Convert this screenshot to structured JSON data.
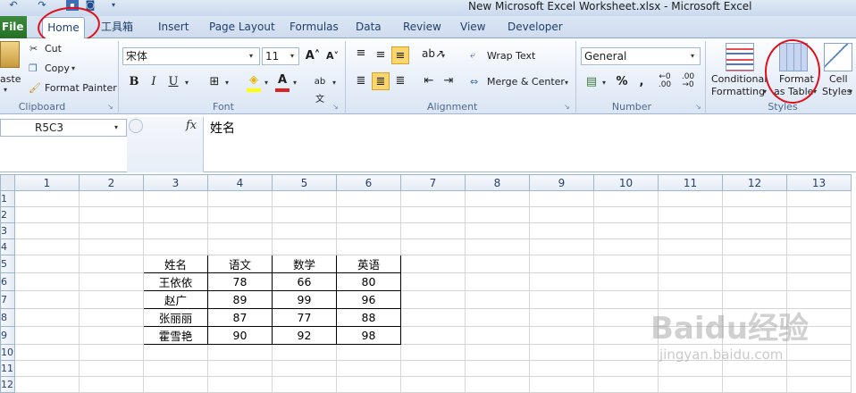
{
  "window": {
    "title": "New Microsoft Excel Worksheet.xlsx  -  Microsoft Excel"
  },
  "quick_access": {
    "icons": [
      "undo-icon",
      "redo-icon",
      "save-icon",
      "camera-icon",
      "customize-dropdown-icon"
    ]
  },
  "tabs": {
    "file": "File",
    "home": "Home",
    "items": [
      "工具箱",
      "Insert",
      "Page Layout",
      "Formulas",
      "Data",
      "Review",
      "View",
      "Developer"
    ]
  },
  "clipboard": {
    "paste": "aste",
    "cut": "Cut",
    "copy": "Copy",
    "format_painter": "Format Painter",
    "label": "Clipboard"
  },
  "font": {
    "name": "宋体",
    "size": "11",
    "label": "Font",
    "bold": "B",
    "italic": "I",
    "underline": "U"
  },
  "alignment": {
    "wrap_text": "Wrap Text",
    "merge_center": "Merge & Center",
    "label": "Alignment"
  },
  "number": {
    "format": "General",
    "percent": "%",
    "comma": ",",
    "label": "Number"
  },
  "styles": {
    "conditional_1": "Conditional",
    "conditional_2": "Formatting",
    "format_table_1": "Format",
    "format_table_2": "as Table",
    "cell_1": "Cell",
    "cell_2": "Styles",
    "label": "Styles"
  },
  "formula_bar": {
    "name_box": "R5C3",
    "fx": "fx",
    "content": "姓名"
  },
  "sheet": {
    "columns": [
      "1",
      "2",
      "3",
      "4",
      "5",
      "6",
      "7",
      "8",
      "9",
      "10",
      "11",
      "12",
      "13"
    ],
    "rows": [
      "1",
      "2",
      "3",
      "4",
      "5",
      "6",
      "7",
      "8",
      "9",
      "10",
      "11",
      "12"
    ],
    "table_header": [
      "姓名",
      "语文",
      "数学",
      "英语"
    ],
    "table_rows": [
      [
        "王依依",
        "78",
        "66",
        "80"
      ],
      [
        "赵广",
        "89",
        "99",
        "96"
      ],
      [
        "张丽丽",
        "87",
        "77",
        "88"
      ],
      [
        "霍雪艳",
        "90",
        "92",
        "98"
      ]
    ]
  },
  "watermark": {
    "main": "Baidu经验",
    "sub": "jingyan.baidu.com"
  },
  "colors": {
    "file_tab": "#267026",
    "ribbon_bg": "#e4ecf7",
    "annotation_red": "#e0101a",
    "header_bg": "#e4ebf4"
  }
}
